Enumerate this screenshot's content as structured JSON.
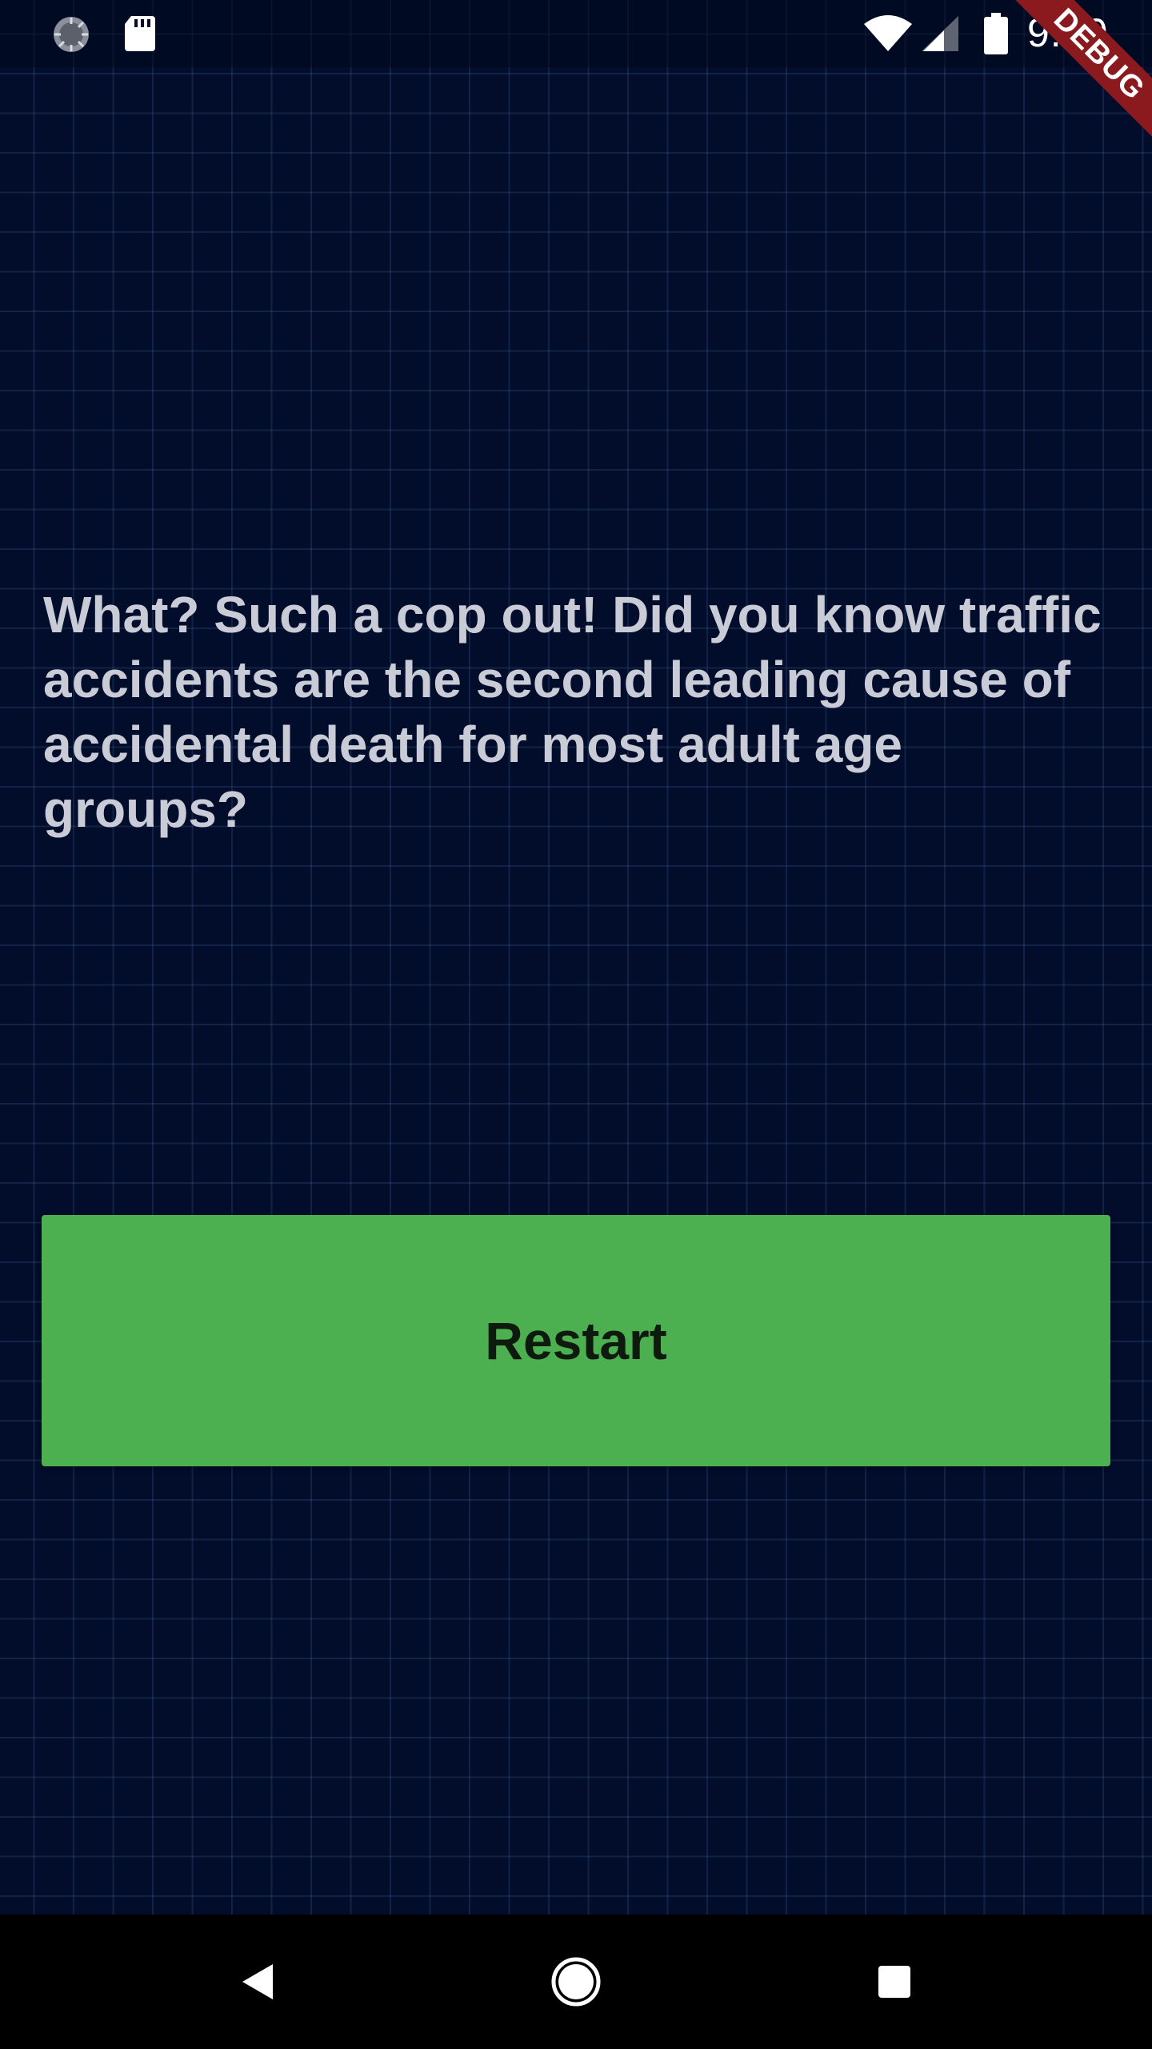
{
  "status_bar": {
    "time": "9:10",
    "icons": [
      "loading-icon",
      "sd-card-icon",
      "wifi-icon",
      "cell-signal-icon",
      "battery-icon"
    ]
  },
  "debug_banner": {
    "label": "DEBUG",
    "color": "#8b1a1f"
  },
  "message": {
    "text": "What? Such a cop out! Did you know traffic accidents are the second leading cause of accidental death for most adult age groups?"
  },
  "restart_button": {
    "label": "Restart",
    "color": "#4caf50"
  },
  "navigation_bar": {
    "buttons": [
      "back-icon",
      "home-icon",
      "recents-icon"
    ]
  },
  "colors": {
    "background": "#020d2b",
    "text": "#c9ccd6",
    "button_text": "#0e1a0e"
  }
}
